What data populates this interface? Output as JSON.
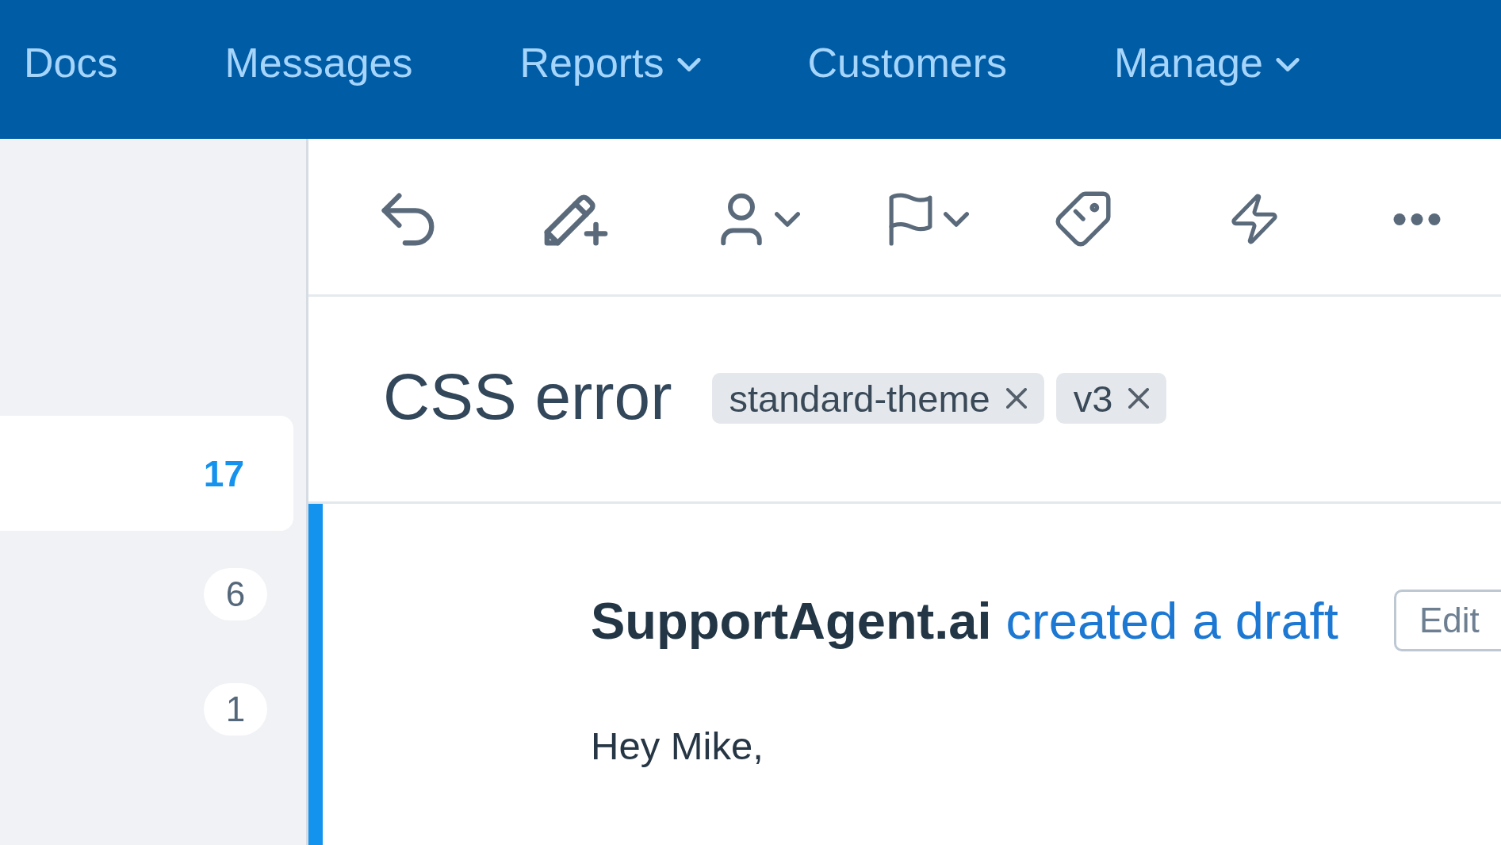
{
  "nav": {
    "items": [
      {
        "label": "Docs",
        "dropdown": false
      },
      {
        "label": "Messages",
        "dropdown": false
      },
      {
        "label": "Reports",
        "dropdown": true
      },
      {
        "label": "Customers",
        "dropdown": false
      },
      {
        "label": "Manage",
        "dropdown": true
      }
    ]
  },
  "sidebar": {
    "items": [
      {
        "count": "17",
        "selected": true
      },
      {
        "count": "6",
        "selected": false
      },
      {
        "count": "1",
        "selected": false
      }
    ]
  },
  "toolbar": {
    "buttons": [
      {
        "kind": "undo",
        "dropdown": false
      },
      {
        "kind": "note",
        "dropdown": false
      },
      {
        "kind": "assign",
        "dropdown": true
      },
      {
        "kind": "flag",
        "dropdown": true
      },
      {
        "kind": "tag",
        "dropdown": false
      },
      {
        "kind": "workflow",
        "dropdown": false
      },
      {
        "kind": "more",
        "dropdown": false
      }
    ]
  },
  "conversation": {
    "subject": "CSS error",
    "tags": [
      {
        "label": "standard-theme"
      },
      {
        "label": "v3"
      }
    ],
    "draft": {
      "author": "SupportAgent.ai",
      "action": "created a draft",
      "edit": "Edit",
      "body": "Hey Mike,"
    }
  }
}
